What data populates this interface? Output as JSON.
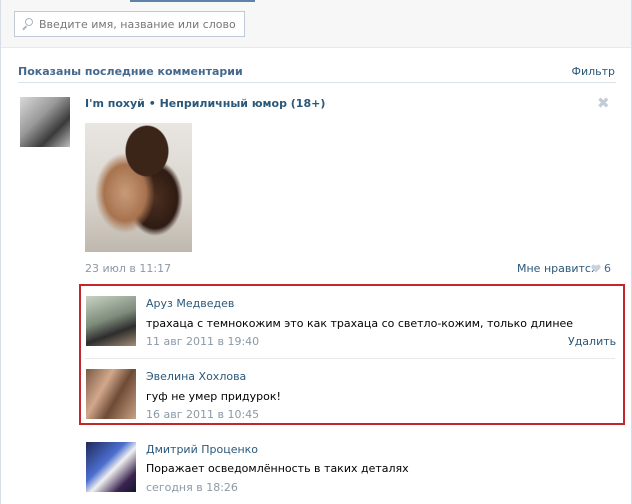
{
  "search": {
    "placeholder": "Введите имя, название или слово"
  },
  "header": {
    "title": "Показаны последние комментарии",
    "filter": "Фильтр"
  },
  "post": {
    "title": "I'm похуй • Неприличный юмор (18+)",
    "close_symbol": "✖",
    "date": "23 июл в 11:17",
    "like_label": "Мне нравится",
    "like_count": "6"
  },
  "comments": [
    {
      "author": "Аруз Медведев",
      "text": "трахаца с темнокожим это как трахаца со светло-кожим, только длинее",
      "time": "11 авг 2011 в 19:40",
      "action": "Удалить"
    },
    {
      "author": "Эвелина Хохлова",
      "text": "гуф не умер придурок!",
      "time": "16 авг 2011 в 10:45"
    },
    {
      "author": "Дмитрий Проценко",
      "text": "Поражает осведомлённость в таких деталях",
      "time": "сегодня в 18:26"
    }
  ],
  "colors": {
    "link": "#2b587a",
    "header": "#45688e",
    "muted": "#8a99a8",
    "highlight_border": "#c1272d"
  }
}
